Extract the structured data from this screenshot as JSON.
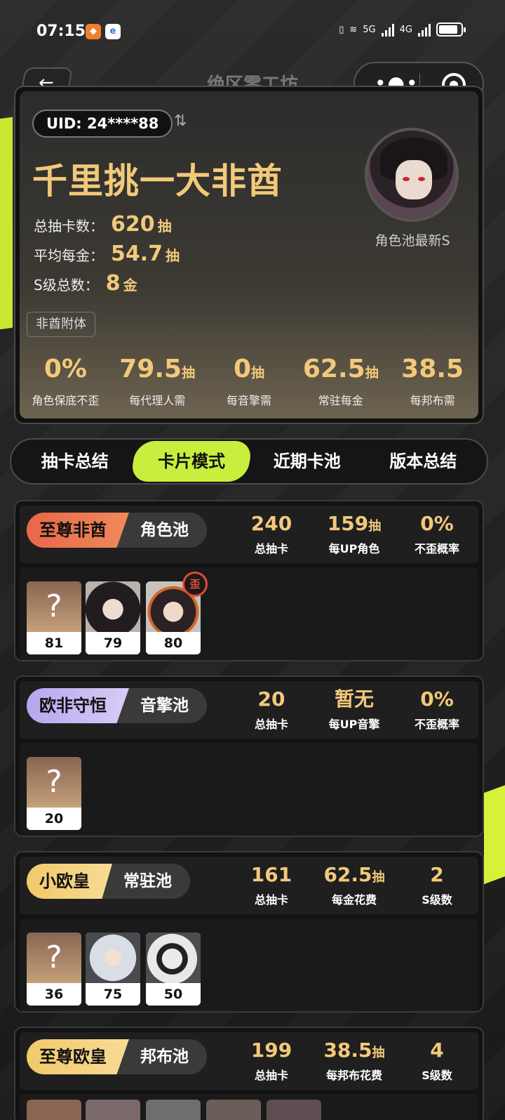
{
  "status_bar": {
    "time": "07:15",
    "net1": "5G",
    "net2": "4G"
  },
  "nav": {
    "title": "绝区零工坊",
    "back": "←"
  },
  "profile": {
    "uid": "UID: 24****88",
    "title": "千里挑一大非酋",
    "stats": [
      {
        "label": "总抽卡数：",
        "value": "620",
        "unit": "抽"
      },
      {
        "label": "平均每金：",
        "value": "54.7",
        "unit": "抽"
      },
      {
        "label": "S级总数：",
        "value": "8",
        "unit": "金"
      }
    ],
    "avatar_label": "角色池最新S",
    "tag": "非酋附体",
    "metrics": [
      {
        "value": "0%",
        "unit": "",
        "label": "角色保底不歪"
      },
      {
        "value": "79.5",
        "unit": "抽",
        "label": "每代理人需"
      },
      {
        "value": "0",
        "unit": "抽",
        "label": "每音擎需"
      },
      {
        "value": "62.5",
        "unit": "抽",
        "label": "常驻每金"
      },
      {
        "value": "38.5",
        "unit": "",
        "label": "每邦布需"
      }
    ]
  },
  "tabs": [
    "抽卡总结",
    "卡片模式",
    "近期卡池",
    "版本总结"
  ],
  "active_tab": 1,
  "pools": [
    {
      "rank": "至尊非酋",
      "rank_color": "#e8674a",
      "type": "角色池",
      "stats": [
        {
          "value": "240",
          "unit": "",
          "label": "总抽卡"
        },
        {
          "value": "159",
          "unit": "抽",
          "label": "每UP角色"
        },
        {
          "value": "0%",
          "unit": "",
          "label": "不歪概率"
        }
      ],
      "cards": [
        {
          "num": "81",
          "art": "?"
        },
        {
          "num": "79"
        },
        {
          "num": "80",
          "badge": "歪"
        }
      ]
    },
    {
      "rank": "欧非守恒",
      "rank_color": "#c4b4f0",
      "type": "音擎池",
      "stats": [
        {
          "value": "20",
          "unit": "",
          "label": "总抽卡"
        },
        {
          "value": "暂无",
          "unit": "",
          "label": "每UP音擎"
        },
        {
          "value": "0%",
          "unit": "",
          "label": "不歪概率"
        }
      ],
      "cards": [
        {
          "num": "20",
          "art": "?"
        }
      ]
    },
    {
      "rank": "小欧皇",
      "rank_color": "#f2c96a",
      "type": "常驻池",
      "stats": [
        {
          "value": "161",
          "unit": "",
          "label": "总抽卡"
        },
        {
          "value": "62.5",
          "unit": "抽",
          "label": "每金花费"
        },
        {
          "value": "2",
          "unit": "",
          "label": "S级数"
        }
      ],
      "cards": [
        {
          "num": "36",
          "art": "?"
        },
        {
          "num": "75"
        },
        {
          "num": "50"
        }
      ]
    },
    {
      "rank": "至尊欧皇",
      "rank_color": "#f2c96a",
      "type": "邦布池",
      "stats": [
        {
          "value": "199",
          "unit": "",
          "label": "总抽卡"
        },
        {
          "value": "38.5",
          "unit": "抽",
          "label": "每邦布花费"
        },
        {
          "value": "4",
          "unit": "",
          "label": "S级数"
        }
      ]
    }
  ]
}
